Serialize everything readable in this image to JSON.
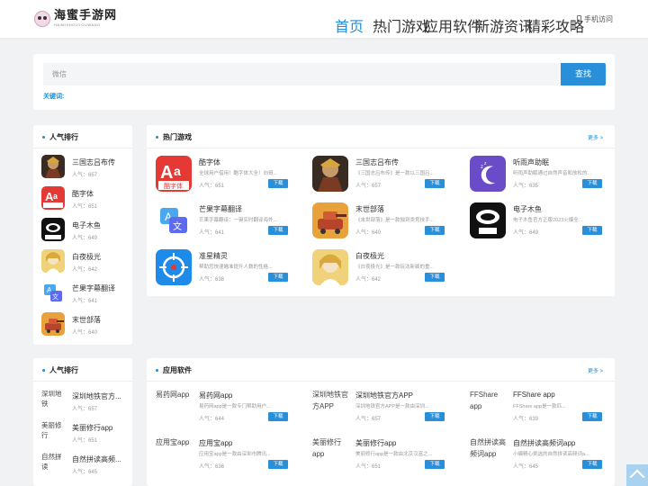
{
  "header": {
    "logo_title": "海蜜手游网",
    "logo_sub": "HAIMISHOUYOUWANG",
    "nav": [
      "首页",
      "热门游戏",
      "应用软件",
      "新游资讯",
      "精彩攻略"
    ],
    "mobile": "手机访问"
  },
  "search": {
    "placeholder": "微信",
    "button": "查找",
    "keywords_label": "关键词:"
  },
  "colors": {
    "accent": "#2a8fd9",
    "background": "#f1f2f4"
  },
  "rank1": {
    "title": "人气排行",
    "items": [
      {
        "name": "三国志吕布传",
        "pop": "人气：657"
      },
      {
        "name": "酷字体",
        "pop": "人气：651"
      },
      {
        "name": "电子木鱼",
        "pop": "人气：649"
      },
      {
        "name": "白夜极光",
        "pop": "人气：642"
      },
      {
        "name": "芒果字幕翻译",
        "pop": "人气：641"
      },
      {
        "name": "末世部落",
        "pop": "人气：640"
      }
    ]
  },
  "hot": {
    "title": "热门游戏",
    "more": "更多 >",
    "download": "下载",
    "items": [
      {
        "name": "酷字体",
        "desc": "全球用户借用！酷字体大全！向哥...",
        "pop": "人气：651"
      },
      {
        "name": "三国志吕布传",
        "desc": "《三国志吕布传》是一款以三国吕...",
        "pop": "人气：657"
      },
      {
        "name": "听雨声助眠",
        "desc": "听雨声助眠通过自然声音和放松的...",
        "pop": "人气：635"
      },
      {
        "name": "芒果字幕翻译",
        "desc": "芒果字幕翻译：一键实时翻译海外...",
        "pop": "人气：641"
      },
      {
        "name": "末世部落",
        "desc": "《末世部落》是一款独到类竞技手...",
        "pop": "人气：640"
      },
      {
        "name": "电子木鱼",
        "desc": "电子木鱼官方正版2023火爆全...",
        "pop": "人气：649"
      },
      {
        "name": "准星精灵",
        "desc": "帮助您快速瞄准提升人数的性格...",
        "pop": "人气：638"
      },
      {
        "name": "白夜极光",
        "desc": "《白夜极光》是一款玩法新颖的重...",
        "pop": "人气：642"
      }
    ]
  },
  "rank2": {
    "title": "人气排行",
    "items": [
      {
        "alt": "深圳地铁",
        "name": "深圳地铁官方...",
        "pop": "人气：657"
      },
      {
        "alt": "美丽修行",
        "name": "美丽修行app",
        "pop": "人气：651"
      },
      {
        "alt": "自然拼读",
        "name": "自然拼读高频...",
        "pop": "人气：645"
      }
    ]
  },
  "apps": {
    "title": "应用软件",
    "more": "更多 >",
    "download": "下载",
    "items": [
      {
        "alt": "易药网app",
        "name": "易药网app",
        "desc": "易药网app是一款专门帮助用户...",
        "pop": "人气：644"
      },
      {
        "alt": "深圳地铁官方APP",
        "name": "深圳地铁官方APP",
        "desc": "深圳地铁官方APP是一款由深圳...",
        "pop": "人气：657"
      },
      {
        "alt": "FFShare app",
        "name": "FFShare app",
        "desc": "FFShare app是一款匹...",
        "pop": "人气：639"
      },
      {
        "alt": "应用宝app",
        "name": "应用宝app",
        "desc": "应用宝app是一款由深圳市腾讯...",
        "pop": "人气：636"
      },
      {
        "alt": "美丽修行app",
        "name": "美丽修行app",
        "desc": "美丽修行app是一款由北京汉富之...",
        "pop": "人气：651"
      },
      {
        "alt": "自然拼读高频词app",
        "name": "自然拼读高频词app",
        "desc": "小编精心挑选的自然拼读高频词a...",
        "pop": "人气：645"
      }
    ]
  }
}
